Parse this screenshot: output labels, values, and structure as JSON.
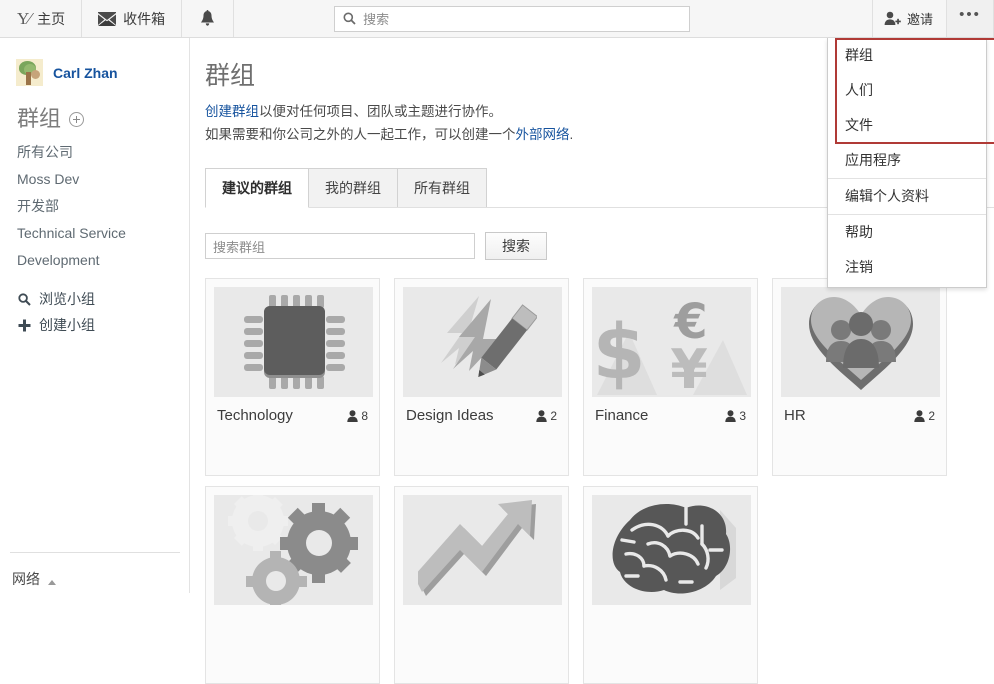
{
  "topbar": {
    "home_label": "主页",
    "home_icon": "yammer-logo-icon",
    "inbox_label": "收件箱",
    "inbox_icon": "envelope-icon",
    "bell_icon": "bell-icon",
    "search_placeholder": "搜索",
    "search_value": "",
    "search_icon": "search-icon",
    "invite_label": "邀请",
    "invite_icon": "person-add-icon",
    "overflow_label": "•••"
  },
  "dropdown": {
    "items": [
      {
        "label": "群组",
        "highlighted": true
      },
      {
        "label": "人们",
        "highlighted": true
      },
      {
        "label": "文件",
        "highlighted": true
      },
      {
        "label": "应用程序",
        "highlighted": false
      },
      {
        "label": "编辑个人资料",
        "highlighted": false
      },
      {
        "label": "帮助",
        "highlighted": false
      },
      {
        "label": "注销",
        "highlighted": false
      }
    ],
    "highlight_color": "#b03a36"
  },
  "sidebar": {
    "user_name": "Carl Zhan",
    "avatar_icon": "user-avatar",
    "section_title": "群组",
    "add_group_icon": "plus-circle-icon",
    "groups": [
      "所有公司",
      "Moss Dev",
      "开发部",
      "Technical Service",
      "Development"
    ],
    "actions": [
      {
        "label": "浏览小组",
        "icon": "search-icon"
      },
      {
        "label": "创建小组",
        "icon": "plus-icon"
      }
    ],
    "network_label": "网络",
    "network_caret_icon": "caret-up-icon"
  },
  "main": {
    "page_title": "群组",
    "desc1_link": "创建群组",
    "desc1_rest": "以便对任何项目、团队或主题进行协作。",
    "desc2_pre": "如果需要和你公司之外的人一起工作，可以创建一个",
    "desc2_link": "外部网络",
    "desc2_post": ".",
    "tabs": [
      {
        "label": "建议的群组",
        "active": true
      },
      {
        "label": "我的群组",
        "active": false
      },
      {
        "label": "所有群组",
        "active": false
      }
    ],
    "group_search_placeholder": "搜索群组",
    "group_search_value": "",
    "group_search_button": "搜索",
    "cards": [
      {
        "name": "Technology",
        "members": "8",
        "icon": "cpu-chip-icon"
      },
      {
        "name": "Design Ideas",
        "members": "2",
        "icon": "lightning-pencil-icon"
      },
      {
        "name": "Finance",
        "members": "3",
        "icon": "currency-symbols-icon"
      },
      {
        "name": "HR",
        "members": "2",
        "icon": "heart-people-icon"
      },
      {
        "name": "",
        "members": "",
        "icon": "gears-icon"
      },
      {
        "name": "",
        "members": "",
        "icon": "growth-arrow-icon"
      },
      {
        "name": "",
        "members": "",
        "icon": "brain-icon"
      }
    ]
  }
}
